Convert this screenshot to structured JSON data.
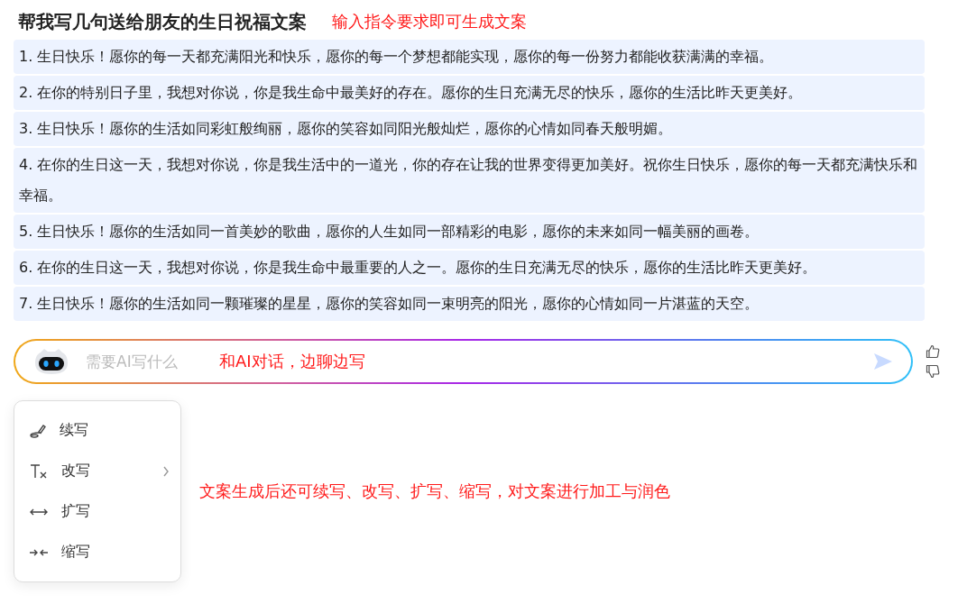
{
  "title": {
    "text": "帮我写几句送给朋友的生日祝福文案",
    "annotation": "输入指令要求即可生成文案"
  },
  "results": [
    "1. 生日快乐！愿你的每一天都充满阳光和快乐，愿你的每一个梦想都能实现，愿你的每一份努力都能收获满满的幸福。",
    "2. 在你的特别日子里，我想对你说，你是我生命中最美好的存在。愿你的生日充满无尽的快乐，愿你的生活比昨天更美好。",
    "3. 生日快乐！愿你的生活如同彩虹般绚丽，愿你的笑容如同阳光般灿烂，愿你的心情如同春天般明媚。",
    "4. 在你的生日这一天，我想对你说，你是我生活中的一道光，你的存在让我的世界变得更加美好。祝你生日快乐，愿你的每一天都充满快乐和幸福。",
    "5. 生日快乐！愿你的生活如同一首美妙的歌曲，愿你的人生如同一部精彩的电影，愿你的未来如同一幅美丽的画卷。",
    "6. 在你的生日这一天，我想对你说，你是我生命中最重要的人之一。愿你的生日充满无尽的快乐，愿你的生活比昨天更美好。",
    "7. 生日快乐！愿你的生活如同一颗璀璨的星星，愿你的笑容如同一束明亮的阳光，愿你的心情如同一片湛蓝的天空。"
  ],
  "input": {
    "placeholder": "需要AI写什么",
    "annotation": "和AI对话，边聊边写"
  },
  "menu": [
    {
      "kind": "continue",
      "label": "续写",
      "submenu": false
    },
    {
      "kind": "rewrite",
      "label": "改写",
      "submenu": true
    },
    {
      "kind": "expand",
      "label": "扩写",
      "submenu": false
    },
    {
      "kind": "shrink",
      "label": "缩写",
      "submenu": false
    }
  ],
  "menu_annotation": "文案生成后还可续写、改写、扩写、缩写，对文案进行加工与润色"
}
